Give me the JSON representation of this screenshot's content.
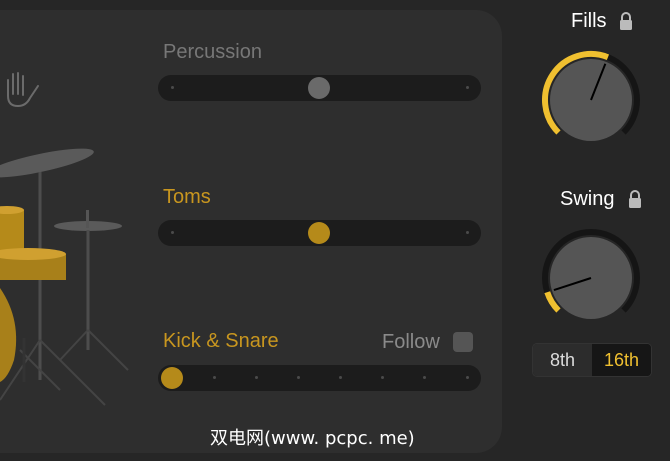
{
  "sliders": {
    "percussion": {
      "label": "Percussion",
      "value": 0.5,
      "active": false
    },
    "toms": {
      "label": "Toms",
      "value": 0.5,
      "active": true
    },
    "kick_snare": {
      "label": "Kick & Snare",
      "value": 0.0,
      "active": true,
      "follow_label": "Follow",
      "follow_checked": false
    }
  },
  "fills": {
    "title": "Fills",
    "value": 0.58
  },
  "swing": {
    "title": "Swing",
    "value": 0.1
  },
  "note_division": {
    "options": [
      "8th",
      "16th"
    ],
    "selected": "16th"
  },
  "watermark": "双电网(www. pcpc. me)",
  "colors": {
    "accent": "#f0c030",
    "gold_label": "#c8961f",
    "drum_gold": "#b58a1a"
  },
  "icons": {
    "hand": "hand-clap-icon",
    "lock": "lock-icon"
  }
}
